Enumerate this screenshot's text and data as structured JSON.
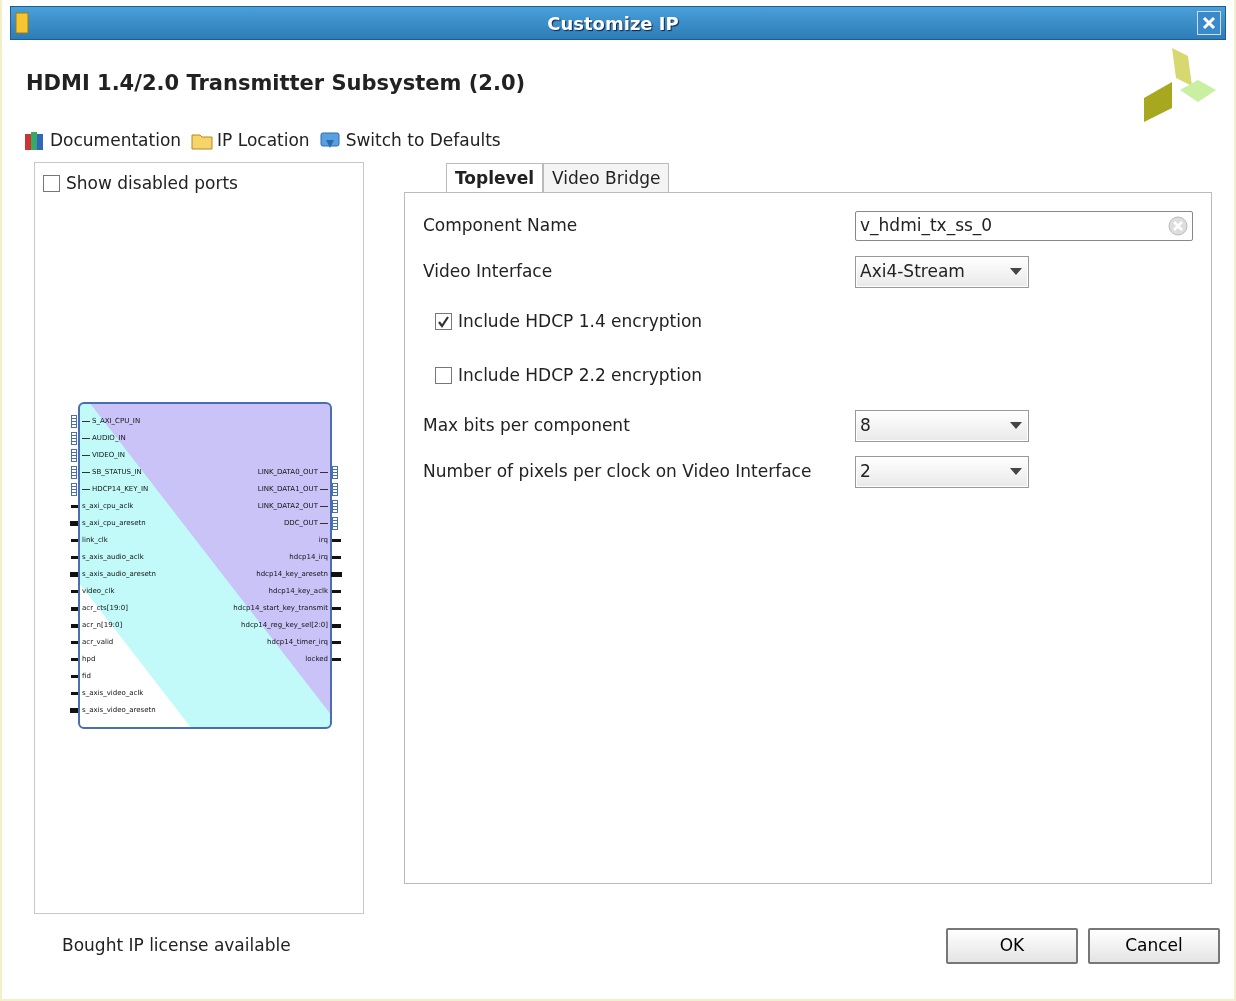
{
  "window": {
    "title": "Customize IP"
  },
  "header": {
    "title": "HDMI 1.4/2.0 Transmitter Subsystem (2.0)"
  },
  "toolbar": [
    {
      "kind": "docs",
      "label": "Documentation"
    },
    {
      "kind": "folder",
      "label": "IP Location"
    },
    {
      "kind": "reset",
      "label": "Switch to Defaults"
    }
  ],
  "symbol_panel": {
    "show_disabled_ports": {
      "label": "Show disabled ports",
      "checked": false
    },
    "left_pins": [
      {
        "kind": "bus",
        "label": "S_AXI_CPU_IN"
      },
      {
        "kind": "bus",
        "label": "AUDIO_IN"
      },
      {
        "kind": "bus",
        "label": "VIDEO_IN"
      },
      {
        "kind": "bus",
        "label": "SB_STATUS_IN"
      },
      {
        "kind": "bus",
        "label": "HDCP14_KEY_IN"
      },
      {
        "kind": "port",
        "label": "s_axi_cpu_aclk"
      },
      {
        "kind": "reset",
        "label": "s_axi_cpu_aresetn"
      },
      {
        "kind": "port",
        "label": "link_clk"
      },
      {
        "kind": "port",
        "label": "s_axis_audio_aclk"
      },
      {
        "kind": "reset",
        "label": "s_axis_audio_aresetn"
      },
      {
        "kind": "port",
        "label": "video_clk"
      },
      {
        "kind": "vector",
        "label": "acr_cts[19:0]"
      },
      {
        "kind": "vector",
        "label": "acr_n[19:0]"
      },
      {
        "kind": "port",
        "label": "acr_valid"
      },
      {
        "kind": "port",
        "label": "hpd"
      },
      {
        "kind": "port",
        "label": "fid"
      },
      {
        "kind": "port",
        "label": "s_axis_video_aclk"
      },
      {
        "kind": "reset",
        "label": "s_axis_video_aresetn"
      }
    ],
    "right_pins": [
      {
        "kind": "bus",
        "label": "LINK_DATA0_OUT"
      },
      {
        "kind": "bus",
        "label": "LINK_DATA1_OUT"
      },
      {
        "kind": "bus",
        "label": "LINK_DATA2_OUT"
      },
      {
        "kind": "bus",
        "label": "DDC_OUT"
      },
      {
        "kind": "port",
        "label": "irq"
      },
      {
        "kind": "port",
        "label": "hdcp14_irq"
      },
      {
        "kind": "reset",
        "label": "hdcp14_key_aresetn"
      },
      {
        "kind": "port",
        "label": "hdcp14_key_aclk"
      },
      {
        "kind": "port",
        "label": "hdcp14_start_key_transmit"
      },
      {
        "kind": "vector",
        "label": "hdcp14_reg_key_sel[2:0]"
      },
      {
        "kind": "port",
        "label": "hdcp14_timer_irq"
      },
      {
        "kind": "port",
        "label": "locked"
      }
    ]
  },
  "tabs": [
    {
      "label": "Toplevel",
      "selected": true
    },
    {
      "label": "Video Bridge",
      "selected": false
    }
  ],
  "fields": [
    {
      "kind": "text",
      "label": "Component Name",
      "value": "v_hdmi_tx_ss_0"
    },
    {
      "kind": "select",
      "label": "Video Interface",
      "value": "Axi4-Stream"
    },
    {
      "kind": "checkbox",
      "label": "Include HDCP 1.4 encryption",
      "checked": true
    },
    {
      "kind": "checkbox",
      "label": "Include HDCP 2.2 encryption",
      "checked": false
    },
    {
      "kind": "select",
      "label": "Max bits per component",
      "value": "8"
    },
    {
      "kind": "select",
      "label": "Number of pixels per clock on Video Interface",
      "value": "2"
    }
  ],
  "status": "Bought IP license available",
  "buttons": [
    "OK",
    "Cancel"
  ]
}
